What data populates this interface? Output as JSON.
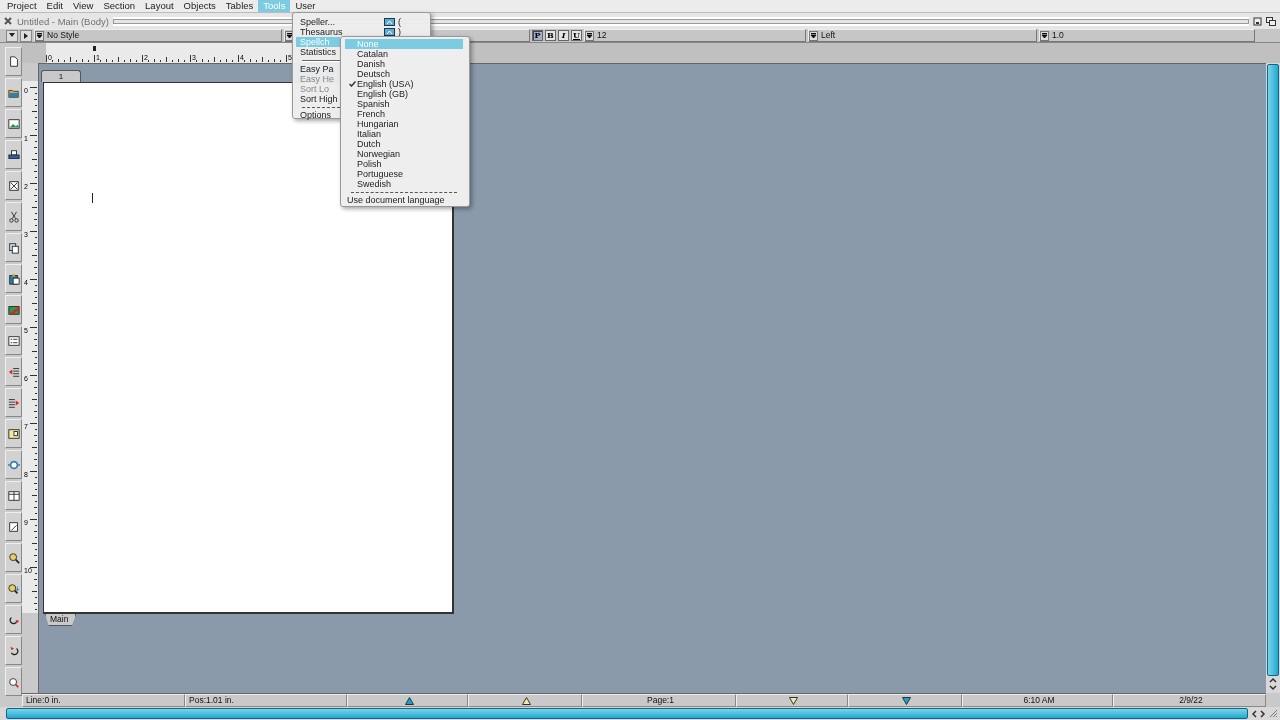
{
  "menu_bar": [
    {
      "label": "Project",
      "selected": false
    },
    {
      "label": "Edit",
      "selected": false
    },
    {
      "label": "View",
      "selected": false
    },
    {
      "label": "Section",
      "selected": false
    },
    {
      "label": "Layout",
      "selected": false
    },
    {
      "label": "Objects",
      "selected": false
    },
    {
      "label": "Tables",
      "selected": false
    },
    {
      "label": "Tools",
      "selected": true
    },
    {
      "label": "User",
      "selected": false
    }
  ],
  "window": {
    "title": "Untitled - Main (Body)"
  },
  "format_bar": {
    "style": "No Style",
    "text_styles": [
      {
        "label": "P",
        "selected": true
      },
      {
        "label": "B",
        "selected": false
      },
      {
        "label": "I",
        "selected": false
      },
      {
        "label": "U",
        "selected": false
      }
    ],
    "font_size": "12",
    "alignment": "Left",
    "line_spacing": "1.0"
  },
  "rulers": {
    "horizontal": [
      "0",
      "1",
      "2",
      "3",
      "4",
      "5"
    ],
    "vertical": [
      "0",
      "1",
      "2",
      "3",
      "4",
      "5",
      "6",
      "7",
      "8",
      "9",
      "10"
    ]
  },
  "document": {
    "page_tab": "1",
    "section_tab": "Main"
  },
  "tools_menu": [
    {
      "kind": "item",
      "label": "Speller...",
      "shortcut": "(",
      "disabled": false,
      "selected": false
    },
    {
      "kind": "item",
      "label": "Thesaurus",
      "shortcut": ")",
      "disabled": false,
      "selected": false
    },
    {
      "kind": "item",
      "label": "Spellch",
      "disabled": false,
      "selected": true
    },
    {
      "kind": "item",
      "label": "Statistics",
      "disabled": false,
      "selected": false
    },
    {
      "kind": "separator"
    },
    {
      "kind": "item",
      "label": "Easy Pa",
      "disabled": false,
      "selected": false
    },
    {
      "kind": "item",
      "label": "Easy He",
      "disabled": true,
      "selected": false
    },
    {
      "kind": "item",
      "label": "Sort Lo",
      "disabled": true,
      "selected": false
    },
    {
      "kind": "item",
      "label": "Sort High",
      "disabled": false,
      "selected": false
    },
    {
      "kind": "dashed_separator"
    },
    {
      "kind": "item",
      "label": "Options",
      "disabled": false,
      "selected": false
    }
  ],
  "language_menu": {
    "items": [
      {
        "label": "None",
        "checked": false,
        "selected": true
      },
      {
        "label": "Catalan",
        "checked": false,
        "selected": false
      },
      {
        "label": "Danish",
        "checked": false,
        "selected": false
      },
      {
        "label": "Deutsch",
        "checked": false,
        "selected": false
      },
      {
        "label": "English (USA)",
        "checked": true,
        "selected": false
      },
      {
        "label": "English (GB)",
        "checked": false,
        "selected": false
      },
      {
        "label": "Spanish",
        "checked": false,
        "selected": false
      },
      {
        "label": "French",
        "checked": false,
        "selected": false
      },
      {
        "label": "Hungarian",
        "checked": false,
        "selected": false
      },
      {
        "label": "Italian",
        "checked": false,
        "selected": false
      },
      {
        "label": "Dutch",
        "checked": false,
        "selected": false
      },
      {
        "label": "Norwegian",
        "checked": false,
        "selected": false
      },
      {
        "label": "Polish",
        "checked": false,
        "selected": false
      },
      {
        "label": "Portuguese",
        "checked": false,
        "selected": false
      },
      {
        "label": "Swedish",
        "checked": false,
        "selected": false
      }
    ],
    "footer": "Use document language"
  },
  "status_bar": {
    "line": "Line:0 in.",
    "position": "Pos:1.01 in.",
    "page": "Page:1",
    "time": "6:10 AM",
    "date": "2/9/22"
  }
}
